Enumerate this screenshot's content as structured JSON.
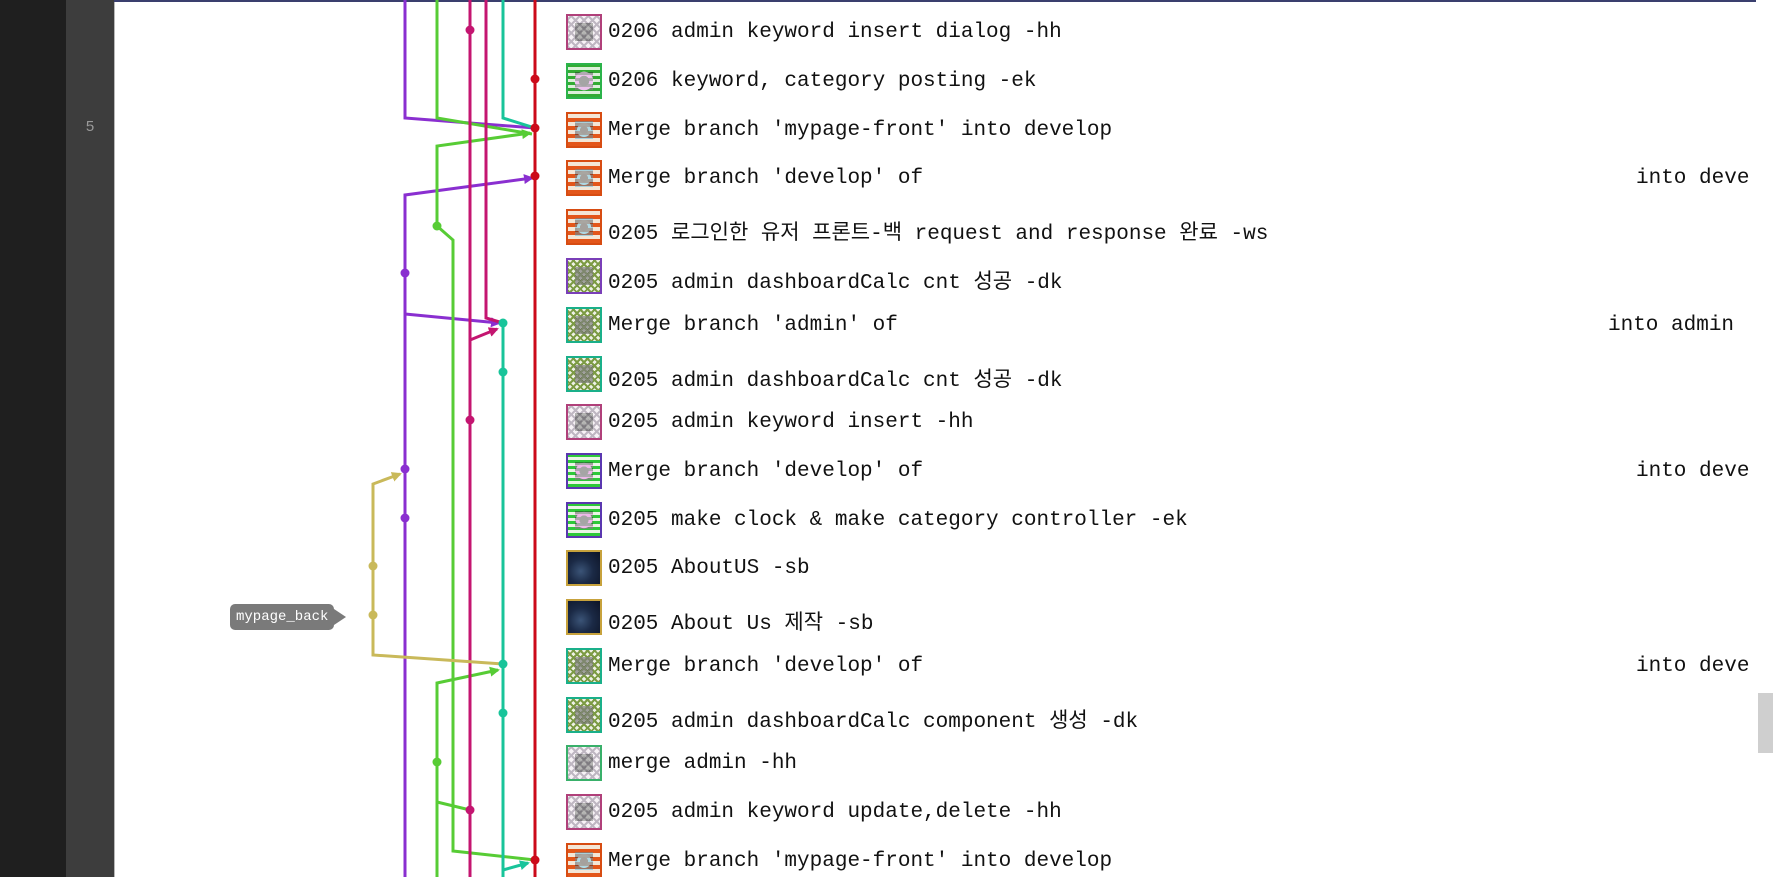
{
  "gutter": {
    "line_number": "5"
  },
  "branch_tag": {
    "label": "mypage_back"
  },
  "colors": {
    "red": "#cc0a1a",
    "purple": "#8a2fd0",
    "green": "#57cc35",
    "magenta": "#c41570",
    "teal": "#18c49a",
    "olive": "#c9b95a"
  },
  "commits": [
    {
      "avatar": "pink-grid-identicon",
      "message": "0206 admin keyword insert dialog -hh",
      "trailing": ""
    },
    {
      "avatar": "green-grid-identicon",
      "message": "0206 keyword, category posting -ek",
      "trailing": ""
    },
    {
      "avatar": "orange-identicon",
      "message": "Merge branch 'mypage-front' into develop",
      "trailing": ""
    },
    {
      "avatar": "orange-identicon",
      "message": "Merge branch 'develop' of",
      "trailing": "into deve"
    },
    {
      "avatar": "orange-identicon",
      "message": "0205 로그인한 유저 프론트-백 request and response 완료 -ws",
      "trailing": ""
    },
    {
      "avatar": "olive-purple-identicon",
      "message": "0205 admin dashboardCalc cnt 성공 -dk",
      "trailing": ""
    },
    {
      "avatar": "olive-teal-identicon",
      "message": "Merge branch 'admin' of",
      "trailing": "into admin"
    },
    {
      "avatar": "olive-teal-identicon",
      "message": "0205 admin dashboardCalc cnt 성공 -dk",
      "trailing": ""
    },
    {
      "avatar": "pink-grid-identicon",
      "message": "0205 admin keyword insert -hh",
      "trailing": ""
    },
    {
      "avatar": "green-purple-identicon",
      "message": "Merge branch 'develop' of",
      "trailing": "into deve"
    },
    {
      "avatar": "green-purple-identicon",
      "message": "0205 make clock & make category controller -ek",
      "trailing": ""
    },
    {
      "avatar": "photo-avatar",
      "message": "0205 AboutUS -sb",
      "trailing": ""
    },
    {
      "avatar": "photo-avatar",
      "message": "0205 About Us 제작 -sb",
      "trailing": ""
    },
    {
      "avatar": "olive-teal-identicon",
      "message": "Merge branch 'develop' of",
      "trailing": "into deve"
    },
    {
      "avatar": "olive-teal-identicon",
      "message": "0205 admin dashboardCalc component 생성 -dk",
      "trailing": ""
    },
    {
      "avatar": "pink-green-identicon",
      "message": "merge admin -hh",
      "trailing": ""
    },
    {
      "avatar": "pink-grid-identicon",
      "message": "0205 admin keyword update,delete -hh",
      "trailing": ""
    },
    {
      "avatar": "orange-identicon",
      "message": "Merge branch 'mypage-front' into develop",
      "trailing": ""
    }
  ]
}
